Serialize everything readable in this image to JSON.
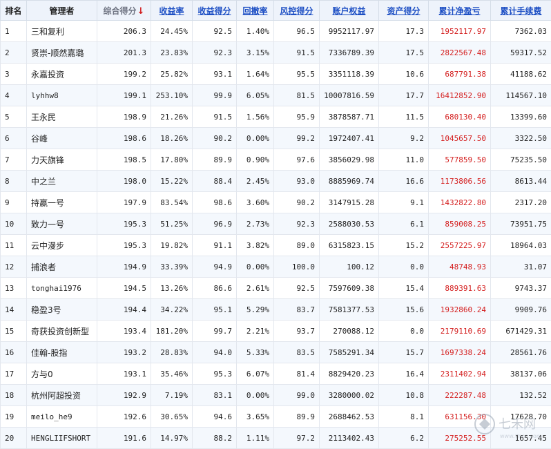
{
  "headers": [
    {
      "key": "rank",
      "label": "排名",
      "style": "plain"
    },
    {
      "key": "manager",
      "label": "管理者",
      "style": "plain"
    },
    {
      "key": "score",
      "label": "综合得分",
      "style": "sorted",
      "arrow": "↓"
    },
    {
      "key": "return_rate",
      "label": "收益率",
      "style": "link"
    },
    {
      "key": "return_score",
      "label": "收益得分",
      "style": "link"
    },
    {
      "key": "drawdown",
      "label": "回撤率",
      "style": "link"
    },
    {
      "key": "risk_score",
      "label": "风控得分",
      "style": "link"
    },
    {
      "key": "equity",
      "label": "账户权益",
      "style": "link"
    },
    {
      "key": "asset_score",
      "label": "资产得分",
      "style": "link"
    },
    {
      "key": "net_profit",
      "label": "累计净盈亏",
      "style": "link"
    },
    {
      "key": "fees",
      "label": "累计手续费",
      "style": "link"
    }
  ],
  "rows": [
    {
      "rank": "1",
      "manager": "三和复利",
      "score": "206.3",
      "return_rate": "24.45%",
      "return_score": "92.5",
      "drawdown": "1.40%",
      "risk_score": "96.5",
      "equity": "9952117.97",
      "asset_score": "17.3",
      "net_profit": "1952117.97",
      "fees": "7362.03"
    },
    {
      "rank": "2",
      "manager": "贤崇-顺然嘉璐",
      "score": "201.3",
      "return_rate": "23.83%",
      "return_score": "92.3",
      "drawdown": "3.15%",
      "risk_score": "91.5",
      "equity": "7336789.39",
      "asset_score": "17.5",
      "net_profit": "2822567.48",
      "fees": "59317.52"
    },
    {
      "rank": "3",
      "manager": "永嘉投资",
      "score": "199.2",
      "return_rate": "25.82%",
      "return_score": "93.1",
      "drawdown": "1.64%",
      "risk_score": "95.5",
      "equity": "3351118.39",
      "asset_score": "10.6",
      "net_profit": "687791.38",
      "fees": "41188.62"
    },
    {
      "rank": "4",
      "manager": "lyhhw8",
      "score": "199.1",
      "return_rate": "253.10%",
      "return_score": "99.9",
      "drawdown": "6.05%",
      "risk_score": "81.5",
      "equity": "10007816.59",
      "asset_score": "17.7",
      "net_profit": "16412852.90",
      "fees": "114567.10"
    },
    {
      "rank": "5",
      "manager": "王永民",
      "score": "198.9",
      "return_rate": "21.26%",
      "return_score": "91.5",
      "drawdown": "1.56%",
      "risk_score": "95.9",
      "equity": "3878587.71",
      "asset_score": "11.5",
      "net_profit": "680130.40",
      "fees": "13399.60"
    },
    {
      "rank": "6",
      "manager": "谷峰",
      "score": "198.6",
      "return_rate": "18.26%",
      "return_score": "90.2",
      "drawdown": "0.00%",
      "risk_score": "99.2",
      "equity": "1972407.41",
      "asset_score": "9.2",
      "net_profit": "1045657.50",
      "fees": "3322.50"
    },
    {
      "rank": "7",
      "manager": "力天旗锋",
      "score": "198.5",
      "return_rate": "17.80%",
      "return_score": "89.9",
      "drawdown": "0.90%",
      "risk_score": "97.6",
      "equity": "3856029.98",
      "asset_score": "11.0",
      "net_profit": "577859.50",
      "fees": "75235.50"
    },
    {
      "rank": "8",
      "manager": "中之兰",
      "score": "198.0",
      "return_rate": "15.22%",
      "return_score": "88.4",
      "drawdown": "2.45%",
      "risk_score": "93.0",
      "equity": "8885969.74",
      "asset_score": "16.6",
      "net_profit": "1173806.56",
      "fees": "8613.44"
    },
    {
      "rank": "9",
      "manager": "持赢一号",
      "score": "197.9",
      "return_rate": "83.54%",
      "return_score": "98.6",
      "drawdown": "3.60%",
      "risk_score": "90.2",
      "equity": "3147915.28",
      "asset_score": "9.1",
      "net_profit": "1432822.80",
      "fees": "2317.20"
    },
    {
      "rank": "10",
      "manager": "致力一号",
      "score": "195.3",
      "return_rate": "51.25%",
      "return_score": "96.9",
      "drawdown": "2.73%",
      "risk_score": "92.3",
      "equity": "2588030.53",
      "asset_score": "6.1",
      "net_profit": "859008.25",
      "fees": "73951.75"
    },
    {
      "rank": "11",
      "manager": "云中漫步",
      "score": "195.3",
      "return_rate": "19.82%",
      "return_score": "91.1",
      "drawdown": "3.82%",
      "risk_score": "89.0",
      "equity": "6315823.15",
      "asset_score": "15.2",
      "net_profit": "2557225.97",
      "fees": "18964.03"
    },
    {
      "rank": "12",
      "manager": "捕浪者",
      "score": "194.9",
      "return_rate": "33.39%",
      "return_score": "94.9",
      "drawdown": "0.00%",
      "risk_score": "100.0",
      "equity": "100.12",
      "asset_score": "0.0",
      "net_profit": "48748.93",
      "fees": "31.07"
    },
    {
      "rank": "13",
      "manager": "tonghai1976",
      "score": "194.5",
      "return_rate": "13.26%",
      "return_score": "86.6",
      "drawdown": "2.61%",
      "risk_score": "92.5",
      "equity": "7597609.38",
      "asset_score": "15.4",
      "net_profit": "889391.63",
      "fees": "9743.37"
    },
    {
      "rank": "14",
      "manager": "稳盈3号",
      "score": "194.4",
      "return_rate": "34.22%",
      "return_score": "95.1",
      "drawdown": "5.29%",
      "risk_score": "83.7",
      "equity": "7581377.53",
      "asset_score": "15.6",
      "net_profit": "1932860.24",
      "fees": "9909.76"
    },
    {
      "rank": "15",
      "manager": "奇获投资创新型",
      "score": "193.4",
      "return_rate": "181.20%",
      "return_score": "99.7",
      "drawdown": "2.21%",
      "risk_score": "93.7",
      "equity": "270088.12",
      "asset_score": "0.0",
      "net_profit": "2179110.69",
      "fees": "671429.31"
    },
    {
      "rank": "16",
      "manager": "佳翰-股指",
      "score": "193.2",
      "return_rate": "28.83%",
      "return_score": "94.0",
      "drawdown": "5.33%",
      "risk_score": "83.5",
      "equity": "7585291.34",
      "asset_score": "15.7",
      "net_profit": "1697338.24",
      "fees": "28561.76"
    },
    {
      "rank": "17",
      "manager": "方与0",
      "score": "193.1",
      "return_rate": "35.46%",
      "return_score": "95.3",
      "drawdown": "6.07%",
      "risk_score": "81.4",
      "equity": "8829420.23",
      "asset_score": "16.4",
      "net_profit": "2311402.94",
      "fees": "38137.06"
    },
    {
      "rank": "18",
      "manager": "杭州阿超投资",
      "score": "192.9",
      "return_rate": "7.19%",
      "return_score": "83.1",
      "drawdown": "0.00%",
      "risk_score": "99.0",
      "equity": "3280000.02",
      "asset_score": "10.8",
      "net_profit": "222287.48",
      "fees": "132.52"
    },
    {
      "rank": "19",
      "manager": "meilo_he9",
      "score": "192.6",
      "return_rate": "30.65%",
      "return_score": "94.6",
      "drawdown": "3.65%",
      "risk_score": "89.9",
      "equity": "2688462.53",
      "asset_score": "8.1",
      "net_profit": "631156.30",
      "fees": "17628.70"
    },
    {
      "rank": "20",
      "manager": "HENGLIIFSHORT",
      "score": "191.6",
      "return_rate": "14.97%",
      "return_score": "88.2",
      "drawdown": "1.11%",
      "risk_score": "97.2",
      "equity": "2113402.43",
      "asset_score": "6.2",
      "net_profit": "275252.55",
      "fees": "1657.45"
    }
  ],
  "colors": {
    "link": "#1d4fc4",
    "profit": "#d41f1f",
    "header_bg": "#eef3fb",
    "stripe": "#f4f8fd"
  },
  "watermark": {
    "text": "七禾网",
    "url": "www.7hcn.com"
  }
}
